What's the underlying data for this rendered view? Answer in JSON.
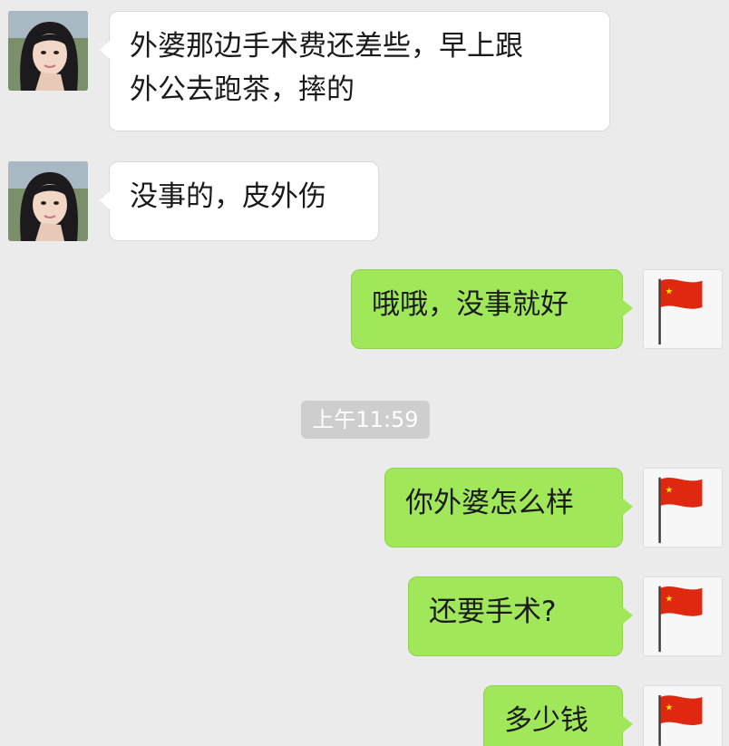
{
  "chat": {
    "messages": [
      {
        "side": "left",
        "text": "外婆那边手术费还差些，早上跟\n外公去跑茶，摔的",
        "avatar": "girl-avatar"
      },
      {
        "side": "left",
        "text": "没事的，皮外伤",
        "avatar": "girl-avatar"
      },
      {
        "side": "right",
        "text": "哦哦，没事就好",
        "avatar": "red-flag-avatar"
      },
      {
        "side": "right",
        "text": "你外婆怎么样",
        "avatar": "red-flag-avatar"
      },
      {
        "side": "right",
        "text": "还要手术?",
        "avatar": "red-flag-avatar"
      },
      {
        "side": "right",
        "text": "多少钱",
        "avatar": "red-flag-avatar"
      }
    ],
    "timestamp": "上午11:59"
  },
  "colors": {
    "background": "#ebebeb",
    "received_bubble": "#ffffff",
    "sent_bubble": "#a0e75a",
    "timestamp_pill": "#cecece",
    "flag_red": "#de2910",
    "flag_star": "#ffde00"
  }
}
